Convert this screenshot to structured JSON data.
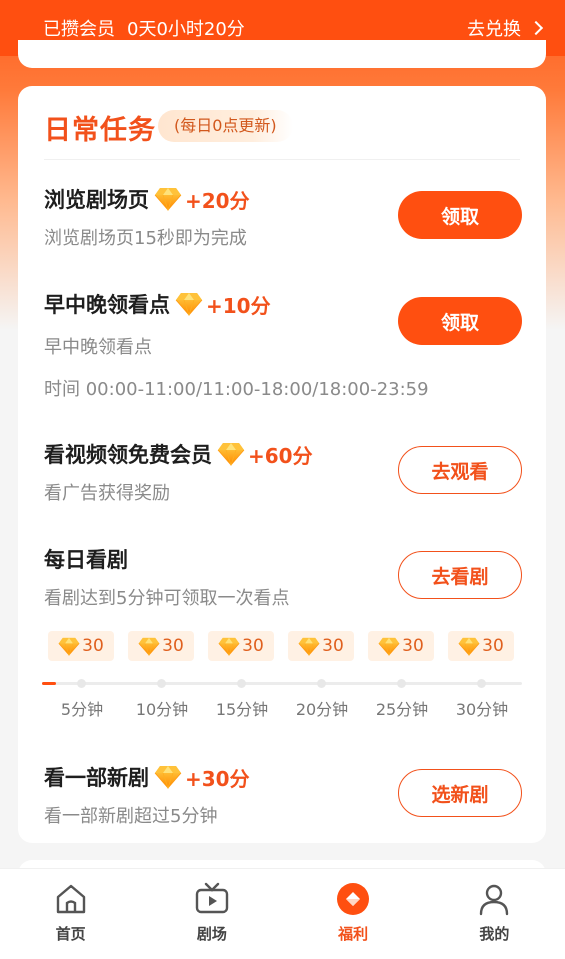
{
  "topbar": {
    "label": "已攒会员",
    "duration": "0天0小时20分",
    "redeem": "去兑换"
  },
  "card": {
    "title": "日常任务",
    "subtitle": "(每日0点更新)"
  },
  "tasks": [
    {
      "title": "浏览剧场页",
      "points": "+20分",
      "desc": "浏览剧场页15秒即为完成",
      "button": "领取"
    },
    {
      "title": "早中晚领看点",
      "points": "+10分",
      "desc": "早中晚领看点",
      "desc2": "时间 00:00-11:00/11:00-18:00/18:00-23:59",
      "button": "领取"
    },
    {
      "title": "看视频领免费会员",
      "points": "+60分",
      "desc": "看广告获得奖励",
      "button": "去观看"
    },
    {
      "title": "每日看剧",
      "desc": "看剧达到5分钟可领取一次看点",
      "button": "去看剧"
    },
    {
      "title": "看一部新剧",
      "points": "+30分",
      "desc": "看一部新剧超过5分钟",
      "button": "选新剧"
    }
  ],
  "watch_rewards": [
    {
      "points": "30",
      "time": "5分钟"
    },
    {
      "points": "30",
      "time": "10分钟"
    },
    {
      "points": "30",
      "time": "15分钟"
    },
    {
      "points": "30",
      "time": "20分钟"
    },
    {
      "points": "30",
      "time": "25分钟"
    },
    {
      "points": "30",
      "time": "30分钟"
    }
  ],
  "watch_progress_fraction": 0.03,
  "nav": [
    {
      "label": "首页",
      "icon": "home-icon"
    },
    {
      "label": "剧场",
      "icon": "tv-icon"
    },
    {
      "label": "福利",
      "icon": "gift-icon"
    },
    {
      "label": "我的",
      "icon": "user-icon"
    }
  ],
  "colors": {
    "accent": "#ff4f10",
    "points": "#f2511b",
    "gem": "#ffa000"
  }
}
